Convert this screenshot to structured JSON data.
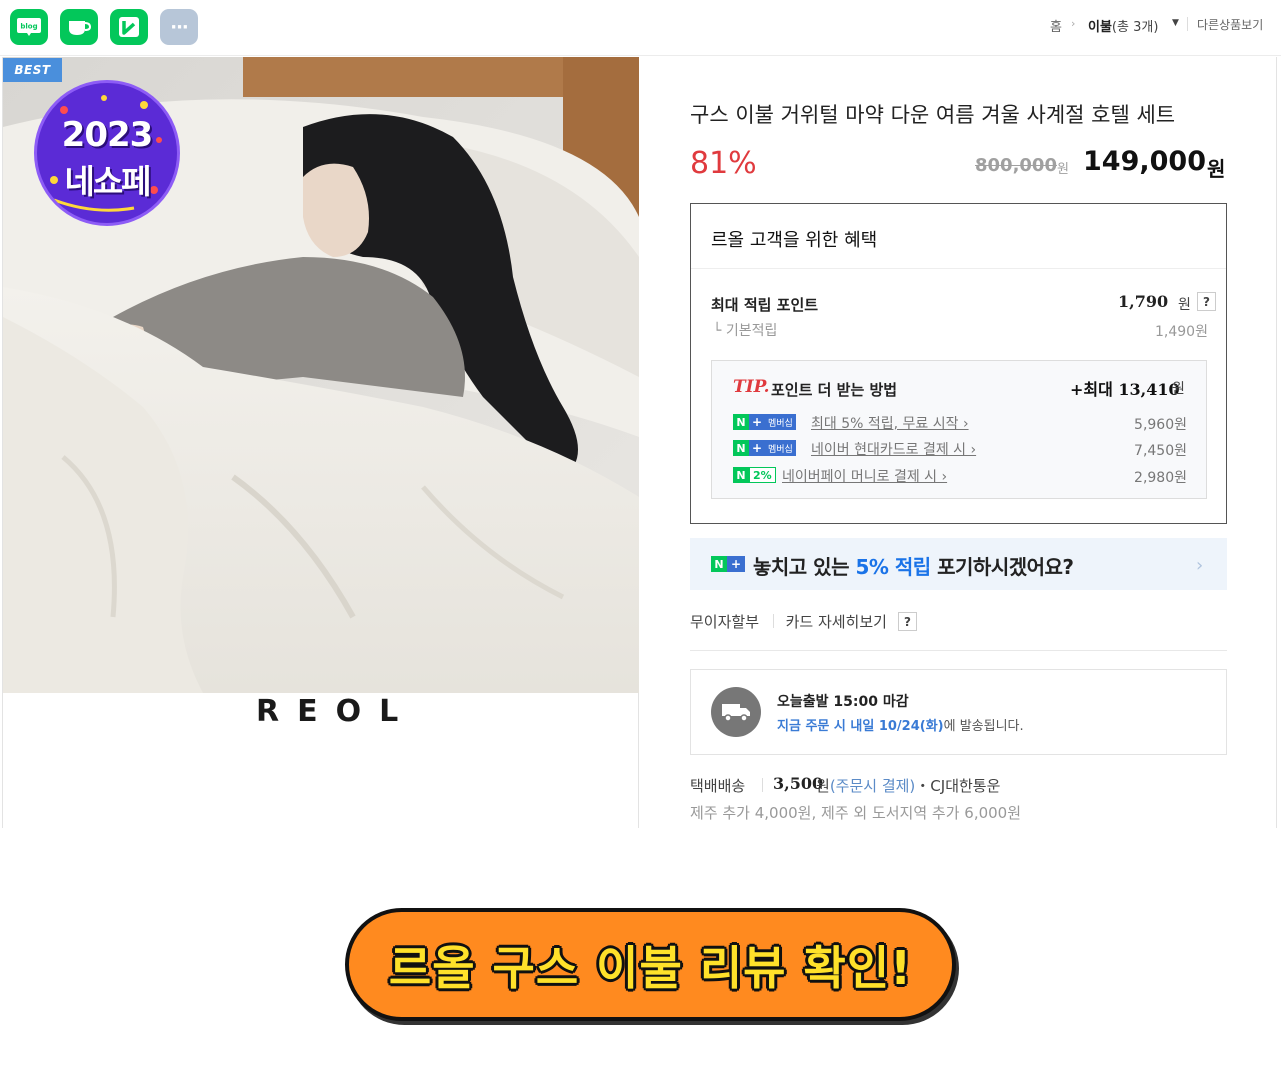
{
  "share": {
    "buttons": [
      {
        "name": "blog",
        "label": "blog"
      },
      {
        "name": "cafe",
        "label": ""
      },
      {
        "name": "band",
        "label": ""
      },
      {
        "name": "more",
        "label": "···"
      }
    ]
  },
  "breadcrumb": {
    "home": "홈",
    "current": "이불",
    "count": "(총 3개)",
    "other": "다른상품보기"
  },
  "image": {
    "best_label": "BEST",
    "badge_year": "2023",
    "badge_event": "네쇼페",
    "brand_text": "REOL"
  },
  "product": {
    "title": "구스 이불 거위털 마약 다운 여름 겨울 사계절 호텔 세트",
    "discount": "81%",
    "original_price": "800,000",
    "original_unit": "원",
    "price": "149,000",
    "price_unit": "원"
  },
  "benefit": {
    "title": "르올 고객을 위한 혜택",
    "max_points_label": "최대 적립 포인트",
    "max_points_value": "1,790",
    "max_points_unit": "원",
    "help": "?",
    "base_label": "└ 기본적립",
    "base_value": "1,490원",
    "tip": {
      "tip_label": "TIP.",
      "desc": "포인트 더 받는 방법",
      "max": "+최대 13,410",
      "max_unit": "원",
      "rows": [
        {
          "badge": "멤버십",
          "link": "최대 5% 적립, 무료 시작 ›",
          "amount": "5,960원"
        },
        {
          "badge": "멤버십",
          "link": "네이버 현대카드로 결제 시 ›",
          "amount": "7,450원"
        },
        {
          "badge": "2%",
          "link": "네이버페이 머니로 결제 시 ›",
          "amount": "2,980원"
        }
      ]
    }
  },
  "promo": {
    "n": "N",
    "plus": "+",
    "text_before": "놓치고 있는 ",
    "highlight": "5% 적립",
    "text_after": " 포기하시겠어요?",
    "arrow": "›"
  },
  "card": {
    "installment": "무이자할부",
    "detail": "카드 자세히보기",
    "help": "?"
  },
  "shipping": {
    "title": "오늘출발 15:00 마감",
    "highlight": "지금 주문 시 내일 10/24(화)",
    "rest": "에 발송됩니다."
  },
  "delivery": {
    "method": "택배배송",
    "fee": "3,500",
    "unit": "원",
    "pay": "(주문시 결제)",
    "carrier": "・CJ대한통운",
    "extra": "제주 추가 4,000원, 제주 외 도서지역 추가 6,000원"
  },
  "cta": {
    "label": "르올 구스 이불 리뷰 확인!"
  },
  "colors": {
    "naver_green": "#03c75a",
    "discount_red": "#e03a3e",
    "cta_orange": "#ff8a1f",
    "cta_text": "#ffe12a",
    "link_blue": "#1a73e8"
  }
}
